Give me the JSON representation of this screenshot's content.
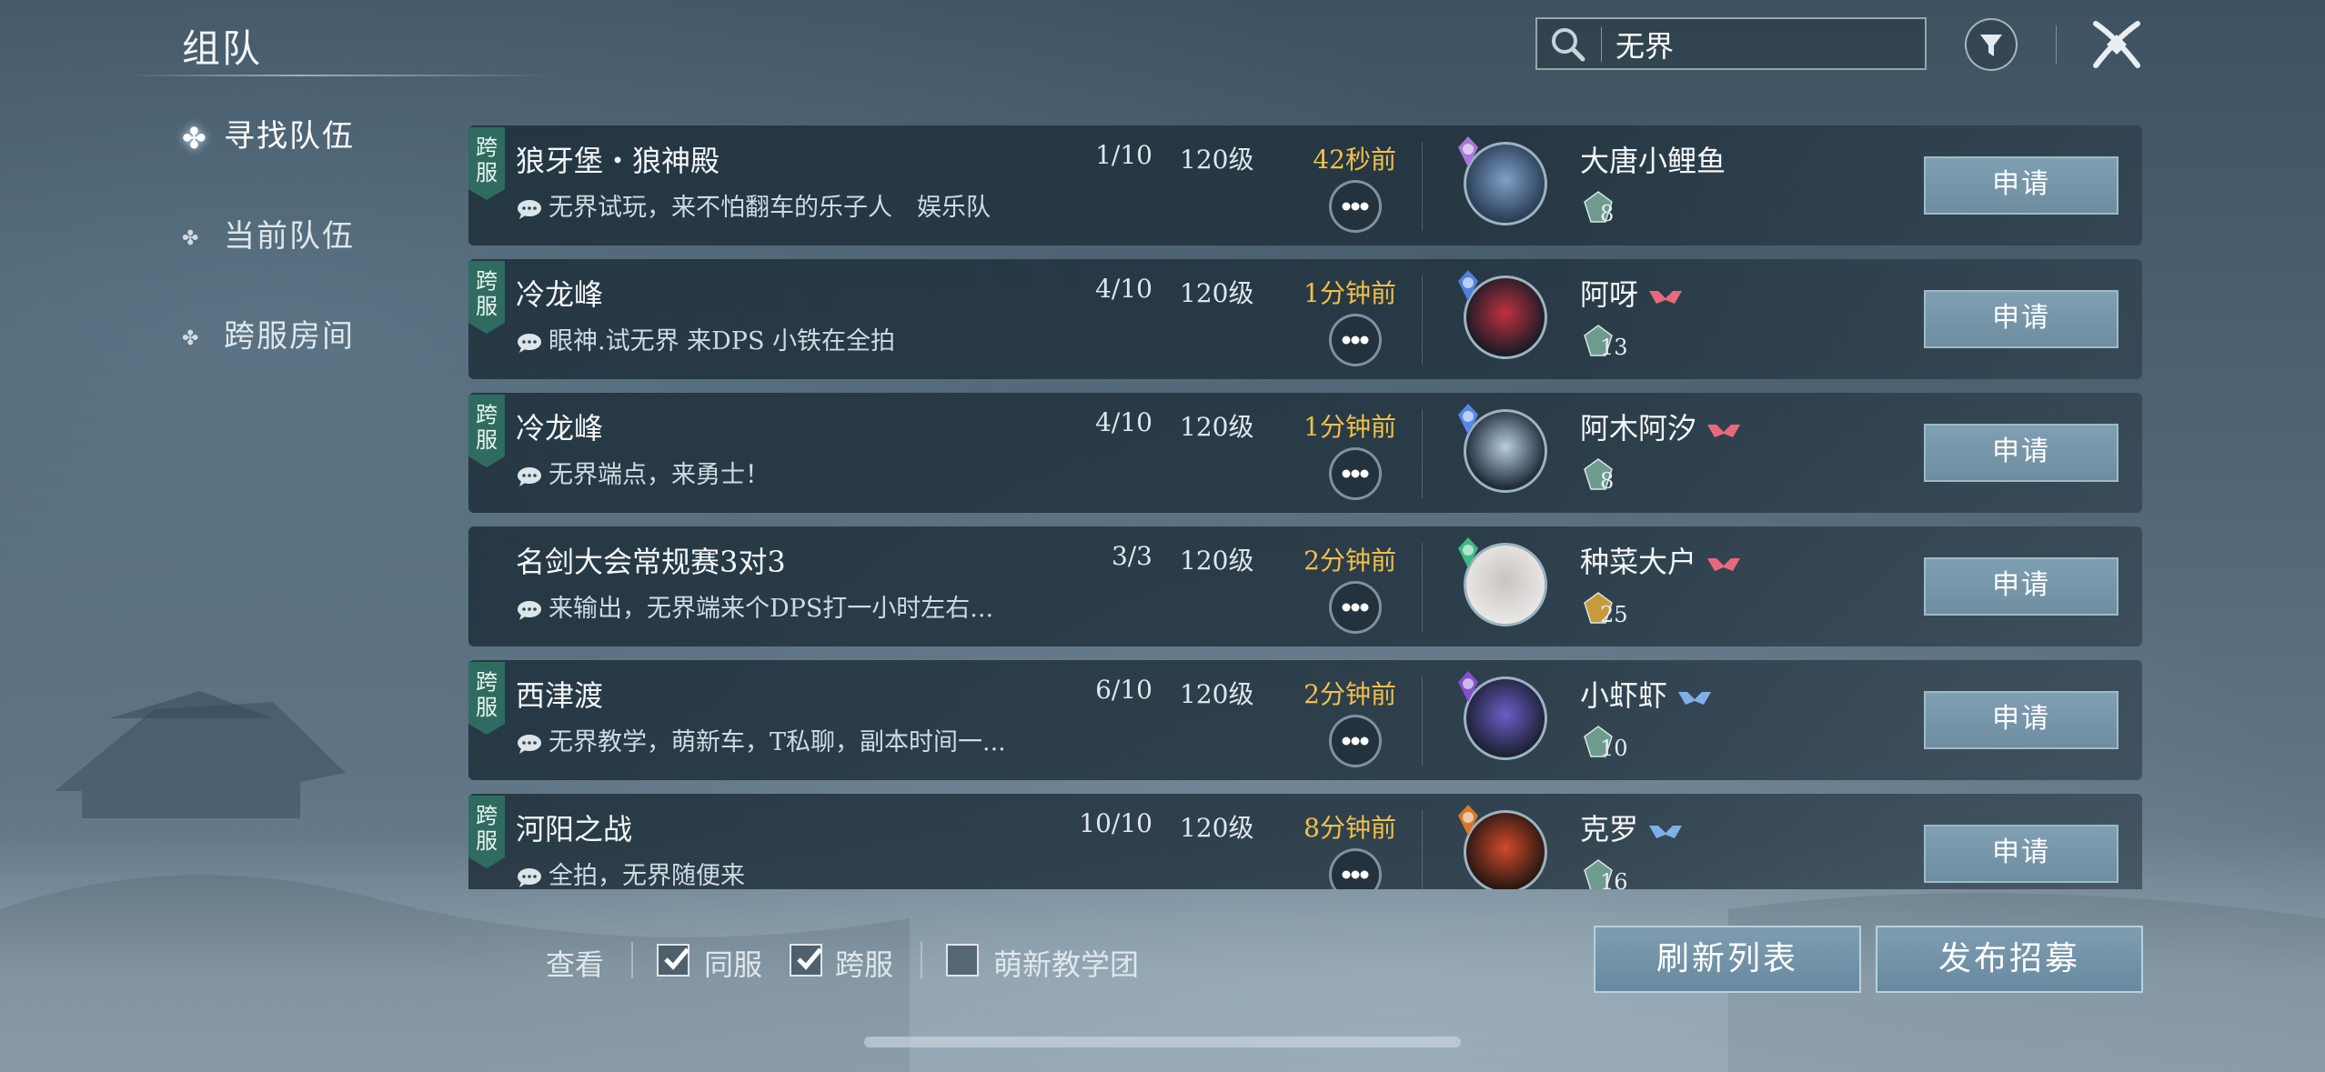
{
  "header": {
    "title": "组队",
    "search_value": "无界",
    "search_placeholder": "无界"
  },
  "sidebar": {
    "items": [
      {
        "label": "寻找队伍",
        "active": true
      },
      {
        "label": "当前队伍",
        "active": false
      },
      {
        "label": "跨服房间",
        "active": false
      }
    ]
  },
  "teams": [
    {
      "cross_tag": "跨服",
      "dungeon": "狼牙堡・狼神殿",
      "count": "1/10",
      "level": "120级",
      "time": "42秒前",
      "message": "无界试玩，来不怕翻车的乐子人　娱乐队",
      "leader": "大唐小鲤鱼",
      "leader_level": "8",
      "has_badge": false,
      "apply": "申请"
    },
    {
      "cross_tag": "跨服",
      "dungeon": "冷龙峰",
      "count": "4/10",
      "level": "120级",
      "time": "1分钟前",
      "message": "眼神.试无界  来DPS 小铁在全拍",
      "leader": "阿呀",
      "leader_level": "13",
      "has_badge": true,
      "apply": "申请"
    },
    {
      "cross_tag": "跨服",
      "dungeon": "冷龙峰",
      "count": "4/10",
      "level": "120级",
      "time": "1分钟前",
      "message": "无界端点，来勇士！",
      "leader": "阿木阿汐",
      "leader_level": "8",
      "has_badge": true,
      "apply": "申请"
    },
    {
      "cross_tag": "",
      "dungeon": "名剑大会常规赛3对3",
      "count": "3/3",
      "level": "120级",
      "time": "2分钟前",
      "message": "来输出，无界端来个DPS打一小时左右...",
      "leader": "种菜大户",
      "leader_level": "25",
      "has_badge": true,
      "apply": "申请"
    },
    {
      "cross_tag": "跨服",
      "dungeon": "西津渡",
      "count": "6/10",
      "level": "120级",
      "time": "2分钟前",
      "message": "无界教学，萌新车，T私聊，副本时间一...",
      "leader": "小虾虾",
      "leader_level": "10",
      "has_badge": true,
      "apply": "申请"
    },
    {
      "cross_tag": "跨服",
      "dungeon": "河阳之战",
      "count": "10/10",
      "level": "120级",
      "time": "8分钟前",
      "message": "全拍，无界随便来",
      "leader": "克罗",
      "leader_level": "16",
      "has_badge": true,
      "apply": "申请"
    }
  ],
  "footer": {
    "view_label": "查看",
    "filters": [
      {
        "label": "同服",
        "checked": true
      },
      {
        "label": "跨服",
        "checked": true
      },
      {
        "label": "萌新教学团",
        "checked": false
      }
    ],
    "refresh_label": "刷新列表",
    "publish_label": "发布招募"
  },
  "colors": {
    "time_accent": "#f0c04a",
    "cross_tag": "#2f6b60",
    "button_fill": "#7596aa"
  }
}
